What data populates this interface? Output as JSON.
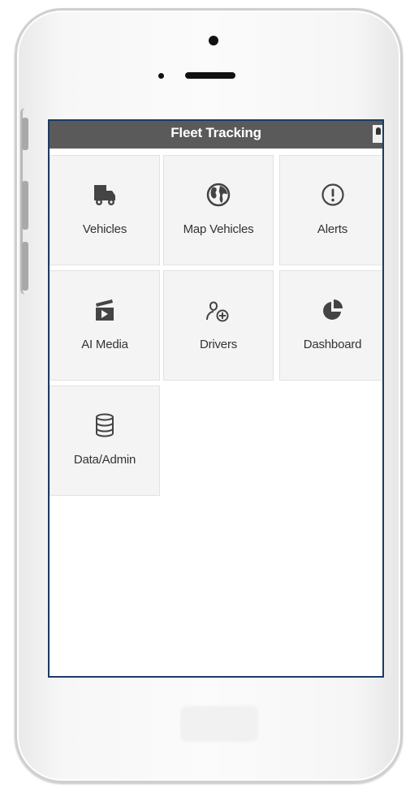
{
  "app": {
    "title": "Fleet Tracking",
    "header_color": "#5a5a5a",
    "screen_border_color": "#1c3b63",
    "tile_color": "#f4f4f4",
    "user_icon": "user-icon"
  },
  "tiles": [
    {
      "label": "Vehicles",
      "icon": "truck-icon"
    },
    {
      "label": "Map Vehicles",
      "icon": "globe-icon"
    },
    {
      "label": "Alerts",
      "icon": "alert-circle-icon"
    },
    {
      "label": "AI Media",
      "icon": "clapperboard-icon"
    },
    {
      "label": "Drivers",
      "icon": "driver-add-icon"
    },
    {
      "label": "Dashboard",
      "icon": "pie-chart-icon"
    },
    {
      "label": "Data/Admin",
      "icon": "database-icon"
    }
  ]
}
